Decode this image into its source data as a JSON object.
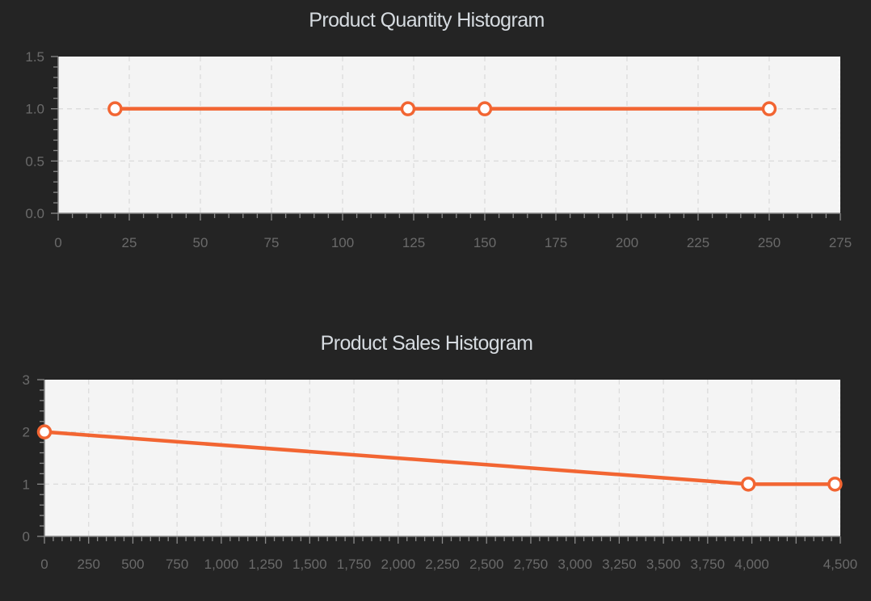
{
  "chart_data": [
    {
      "type": "line",
      "title": "Product Quantity Histogram",
      "xlabel": "",
      "ylabel": "",
      "xlim": [
        0,
        275
      ],
      "ylim": [
        0,
        1.5
      ],
      "x_ticks": [
        0,
        25,
        50,
        75,
        100,
        125,
        150,
        175,
        200,
        225,
        250,
        275
      ],
      "x_tick_labels": [
        "0",
        "25",
        "50",
        "75",
        "100",
        "125",
        "150",
        "175",
        "200",
        "225",
        "250",
        "275"
      ],
      "y_ticks": [
        0,
        0.5,
        1,
        1.5
      ],
      "y_tick_labels": [
        "0.0",
        "0.5",
        "1.0",
        "1.5"
      ],
      "grid": true,
      "color": "#f26532",
      "x": [
        20,
        123,
        150,
        250
      ],
      "y": [
        1,
        1,
        1,
        1
      ]
    },
    {
      "type": "line",
      "title": "Product Sales Histogram",
      "xlabel": "",
      "ylabel": "",
      "xlim": [
        0,
        4500
      ],
      "ylim": [
        0,
        3
      ],
      "x_ticks": [
        0,
        250,
        500,
        750,
        1000,
        1250,
        1500,
        1750,
        2000,
        2250,
        2500,
        2750,
        3000,
        3250,
        3500,
        3750,
        4000,
        4500
      ],
      "x_tick_labels": [
        "0",
        "250",
        "500",
        "750",
        "1,000",
        "1,250",
        "1,500",
        "1,750",
        "2,000",
        "2,250",
        "2,500",
        "2,750",
        "3,000",
        "3,250",
        "3,500",
        "3,750",
        "4,000",
        "4,500"
      ],
      "y_ticks": [
        0,
        1,
        2,
        3
      ],
      "y_tick_labels": [
        "0",
        "1",
        "2",
        "3"
      ],
      "grid": true,
      "color": "#f26532",
      "x": [
        0,
        3980,
        4470
      ],
      "y": [
        2,
        1,
        1
      ]
    }
  ]
}
